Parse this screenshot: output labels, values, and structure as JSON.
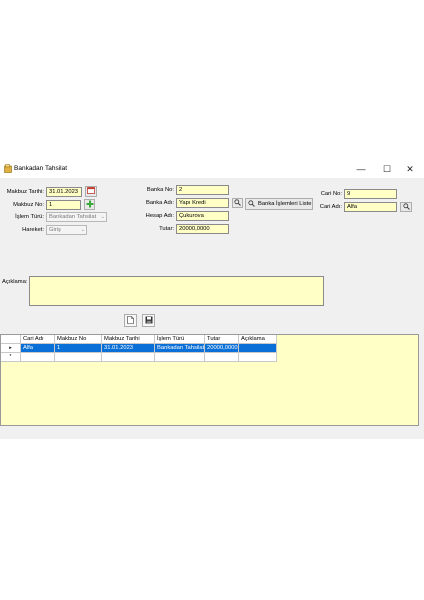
{
  "window": {
    "title": "Bankadan Tahsilat",
    "minimize": "—",
    "maximize": "☐",
    "close": "✕"
  },
  "form": {
    "makbuz_tarihi_label": "Makbuz Tarihi:",
    "makbuz_tarihi_value": "31.01.2023",
    "makbuz_no_label": "Makbuz No:",
    "makbuz_no_value": "1",
    "islem_turu_label": "İşlem Türü:",
    "islem_turu_value": "Bankadan Tahsilat",
    "hareket_label": "Hareket:",
    "hareket_value": "Giriş",
    "banka_no_label": "Banka No:",
    "banka_no_value": "2",
    "banka_adi_label": "Banka Adı:",
    "banka_adi_value": "Yapı Kredi",
    "banka_islemleri_button": "Banka İşlemleri Liste",
    "hesap_adi_label": "Hesap Adı:",
    "hesap_adi_value": "Çukurova",
    "tutar_label": "Tutar:",
    "tutar_value": "20000,0000",
    "cari_no_label": "Cari No:",
    "cari_no_value": "9",
    "cari_adi_label": "Cari Adı:",
    "cari_adi_value": "Alfa",
    "aciklama_label": "Açıklama:",
    "aciklama_value": ""
  },
  "grid": {
    "columns": [
      "Cari Adı",
      "Makbuz No",
      "Makbuz Tarihi",
      "İşlem Türü",
      "Tutar",
      "Açıklama"
    ],
    "rows": [
      [
        "Alfa",
        "1",
        "31.01.2023",
        "Bankadan Tahsilat",
        "20000,0000",
        ""
      ]
    ],
    "current_row_marker": "▸",
    "new_row_marker": "*"
  },
  "icons": {
    "title": "wallet-icon",
    "calendar": "calendar-icon",
    "add": "plus-icon",
    "search": "magnifier-icon",
    "new_doc": "new-document-icon",
    "save": "save-icon"
  },
  "colors": {
    "input_bg": "#ffffc6",
    "selection": "#0a6fd6",
    "window_bg": "#f0f0f0",
    "add_icon": "#3aa83a",
    "calendar_icon": "#c0392b"
  }
}
